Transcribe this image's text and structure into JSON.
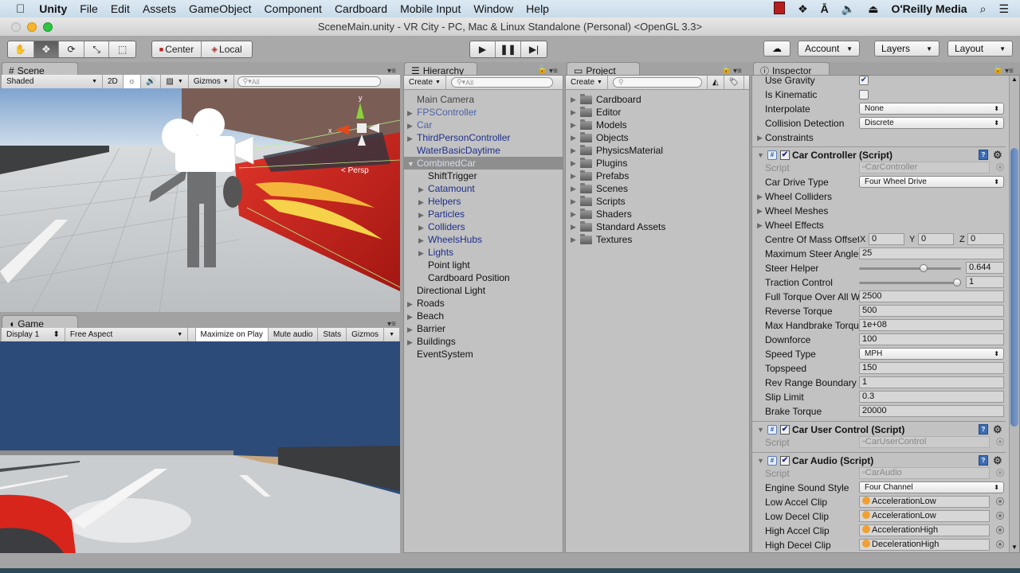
{
  "menubar": {
    "app_name": "Unity",
    "items": [
      "File",
      "Edit",
      "Assets",
      "GameObject",
      "Component",
      "Cardboard",
      "Mobile Input",
      "Window",
      "Help"
    ],
    "user": "O'Reilly Media"
  },
  "window": {
    "title": "SceneMain.unity - VR City - PC, Mac & Linux Standalone (Personal) <OpenGL 3.3>"
  },
  "toolbar": {
    "pivot_label": "Center",
    "space_label": "Local",
    "account_label": "Account",
    "layers_label": "Layers",
    "layout_label": "Layout"
  },
  "scene": {
    "tab_label": "Scene",
    "shading_mode": "Shaded",
    "mode_2d": "2D",
    "gizmos_label": "Gizmos",
    "search_placeholder": "All",
    "persp_label": "< Persp",
    "axis_y": "y",
    "axis_x": "x"
  },
  "game": {
    "tab_label": "Game",
    "display": "Display 1",
    "aspect": "Free Aspect",
    "maximize_on_play": "Maximize on Play",
    "mute_audio": "Mute audio",
    "stats": "Stats",
    "gizmos": "Gizmos"
  },
  "hierarchy": {
    "tab_label": "Hierarchy",
    "create_label": "Create",
    "search_placeholder": "All",
    "items": [
      {
        "label": "Main Camera",
        "depth": 0,
        "expander": "none",
        "style": "normal-gray"
      },
      {
        "label": "FPSController",
        "depth": 0,
        "expander": "collapsed",
        "style": "prefab-light"
      },
      {
        "label": "Car",
        "depth": 0,
        "expander": "collapsed",
        "style": "prefab-light"
      },
      {
        "label": "ThirdPersonController",
        "depth": 0,
        "expander": "collapsed",
        "style": "prefab"
      },
      {
        "label": "WaterBasicDaytime",
        "depth": 0,
        "expander": "none",
        "style": "prefab"
      },
      {
        "label": "CombinedCar",
        "depth": 0,
        "expander": "expanded",
        "style": "selected"
      },
      {
        "label": "ShiftTrigger",
        "depth": 1,
        "expander": "none",
        "style": "normal"
      },
      {
        "label": "Catamount",
        "depth": 1,
        "expander": "collapsed",
        "style": "prefab"
      },
      {
        "label": "Helpers",
        "depth": 1,
        "expander": "collapsed",
        "style": "prefab"
      },
      {
        "label": "Particles",
        "depth": 1,
        "expander": "collapsed",
        "style": "prefab"
      },
      {
        "label": "Colliders",
        "depth": 1,
        "expander": "collapsed",
        "style": "prefab"
      },
      {
        "label": "WheelsHubs",
        "depth": 1,
        "expander": "collapsed",
        "style": "prefab"
      },
      {
        "label": "Lights",
        "depth": 1,
        "expander": "collapsed",
        "style": "prefab"
      },
      {
        "label": "Point light",
        "depth": 1,
        "expander": "none",
        "style": "normal"
      },
      {
        "label": "Cardboard Position",
        "depth": 1,
        "expander": "none",
        "style": "normal"
      },
      {
        "label": "Directional Light",
        "depth": 0,
        "expander": "none",
        "style": "normal"
      },
      {
        "label": "Roads",
        "depth": 0,
        "expander": "collapsed",
        "style": "normal"
      },
      {
        "label": "Beach",
        "depth": 0,
        "expander": "collapsed",
        "style": "normal"
      },
      {
        "label": "Barrier",
        "depth": 0,
        "expander": "collapsed",
        "style": "normal"
      },
      {
        "label": "Buildings",
        "depth": 0,
        "expander": "collapsed",
        "style": "normal"
      },
      {
        "label": "EventSystem",
        "depth": 0,
        "expander": "none",
        "style": "normal"
      }
    ]
  },
  "project": {
    "tab_label": "Project",
    "create_label": "Create",
    "search_placeholder": "",
    "folders": [
      "Cardboard",
      "Editor",
      "Models",
      "Objects",
      "PhysicsMaterial",
      "Plugins",
      "Prefabs",
      "Scenes",
      "Scripts",
      "Shaders",
      "Standard Assets",
      "Textures"
    ]
  },
  "inspector": {
    "tab_label": "Inspector",
    "rigidbody": {
      "use_gravity": {
        "label": "Use Gravity",
        "checked": true
      },
      "is_kinematic": {
        "label": "Is Kinematic",
        "checked": false
      },
      "interpolate": {
        "label": "Interpolate",
        "value": "None"
      },
      "collision_detection": {
        "label": "Collision Detection",
        "value": "Discrete"
      },
      "constraints": {
        "label": "Constraints"
      }
    },
    "car_controller": {
      "title": "Car Controller (Script)",
      "enabled": true,
      "script_label": "Script",
      "script_value": "CarController",
      "drive_type": {
        "label": "Car Drive Type",
        "value": "Four Wheel Drive"
      },
      "wheel_colliders": "Wheel Colliders",
      "wheel_meshes": "Wheel Meshes",
      "wheel_effects": "Wheel Effects",
      "centre_of_mass": {
        "label": "Centre Of Mass Offset",
        "x_label": "X",
        "x": "0",
        "y_label": "Y",
        "y": "0",
        "z_label": "Z",
        "z": "0"
      },
      "max_steer_angle": {
        "label": "Maximum Steer Angle",
        "value": "25"
      },
      "steer_helper": {
        "label": "Steer Helper",
        "value": "0.644",
        "fraction": 0.644
      },
      "traction_control": {
        "label": "Traction Control",
        "value": "1",
        "fraction": 1.0
      },
      "full_torque": {
        "label": "Full Torque Over All Wheels",
        "value": "2500"
      },
      "reverse_torque": {
        "label": "Reverse Torque",
        "value": "500"
      },
      "max_handbrake_torque": {
        "label": "Max Handbrake Torque",
        "value": "1e+08"
      },
      "downforce": {
        "label": "Downforce",
        "value": "100"
      },
      "speed_type": {
        "label": "Speed Type",
        "value": "MPH"
      },
      "topspeed": {
        "label": "Topspeed",
        "value": "150"
      },
      "rev_range_boundary": {
        "label": "Rev Range Boundary",
        "value": "1"
      },
      "slip_limit": {
        "label": "Slip Limit",
        "value": "0.3"
      },
      "brake_torque": {
        "label": "Brake Torque",
        "value": "20000"
      }
    },
    "car_user_control": {
      "title": "Car User Control (Script)",
      "enabled": true,
      "script_label": "Script",
      "script_value": "CarUserControl"
    },
    "car_audio": {
      "title": "Car Audio (Script)",
      "enabled": true,
      "script_label": "Script",
      "script_value": "CarAudio",
      "engine_sound_style": {
        "label": "Engine Sound Style",
        "value": "Four Channel"
      },
      "low_accel_clip": {
        "label": "Low Accel Clip",
        "value": "AccelerationLow"
      },
      "low_decel_clip": {
        "label": "Low Decel Clip",
        "value": "AccelerationLow"
      },
      "high_accel_clip": {
        "label": "High Accel Clip",
        "value": "AccelerationHigh"
      },
      "high_decel_clip": {
        "label": "High Decel Clip",
        "value": "DecelerationHigh"
      }
    },
    "scroll_fraction": 0.35
  },
  "icons": {
    "check": "✔",
    "triangle_right": "▶",
    "triangle_down": "▼",
    "dropdown": "▾",
    "updown": "⬍",
    "gear": "⚙"
  }
}
